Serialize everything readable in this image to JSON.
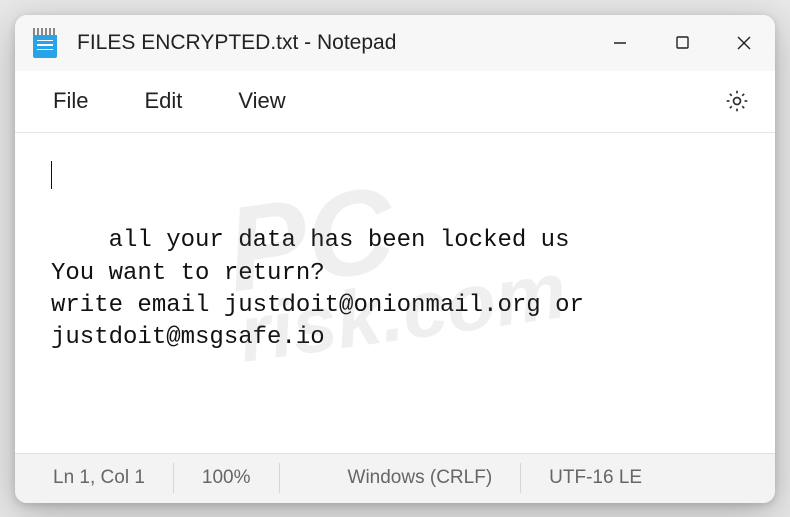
{
  "titlebar": {
    "filename": "FILES ENCRYPTED.txt",
    "appname": "Notepad",
    "title_combined": "FILES ENCRYPTED.txt - Notepad"
  },
  "menu": {
    "file": "File",
    "edit": "Edit",
    "view": "View"
  },
  "editor": {
    "content": "all your data has been locked us\nYou want to return?\nwrite email justdoit@onionmail.org or justdoit@msgsafe.io"
  },
  "statusbar": {
    "cursor": "Ln 1, Col 1",
    "zoom": "100%",
    "line_ending": "Windows (CRLF)",
    "encoding": "UTF-16 LE"
  },
  "icons": {
    "minimize": "minimize-icon",
    "maximize": "maximize-icon",
    "close": "close-icon",
    "settings": "gear-icon",
    "app": "notepad-icon"
  }
}
